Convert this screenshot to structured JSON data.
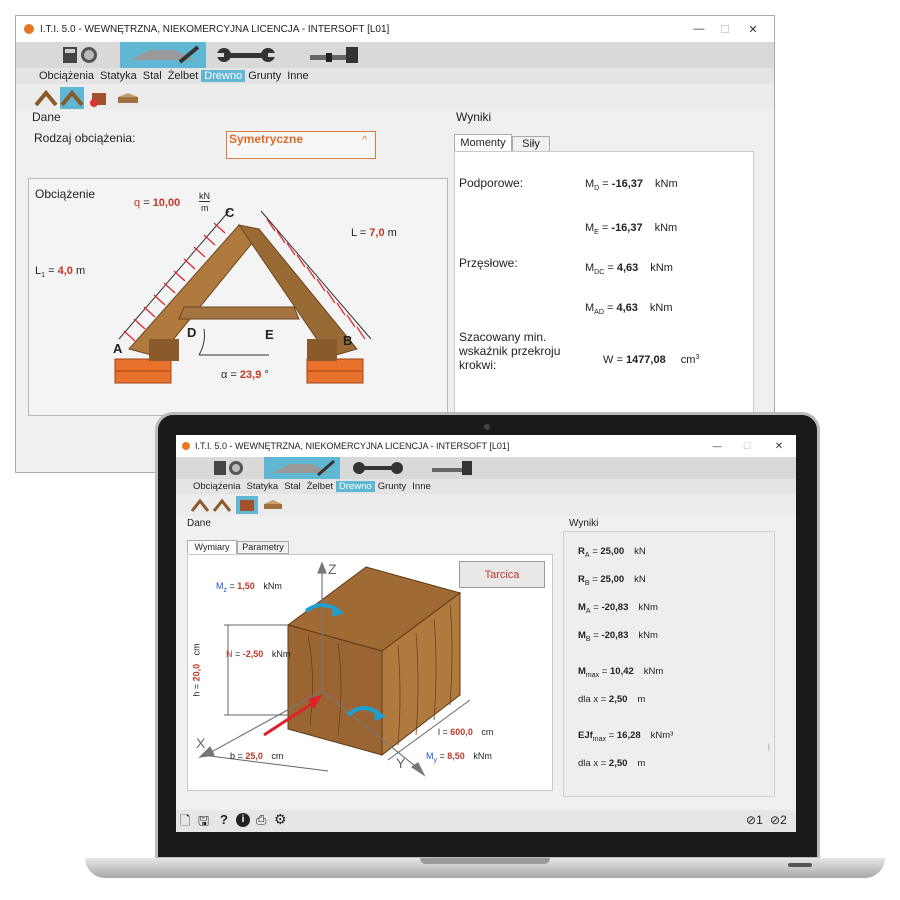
{
  "back": {
    "title": "I.T.I. 5.0 - WEWNĘTRZNA, NIEKOMERCYJNA LICENCJA - INTERSOFT [L01]",
    "controls": {
      "minimize": "—",
      "maximize": "☐",
      "close": "✕"
    },
    "menu": [
      "Obciążenia",
      "Statyka",
      "Stal",
      "Żelbet",
      "Drewno",
      "Grunty",
      "Inne"
    ],
    "menu_active_index": 4,
    "dane_title": "Dane",
    "rodzaj_label": "Rodzaj obciążenia:",
    "rodzaj_value": "Symetryczne",
    "obciazenie_label": "Obciążenie",
    "q_label": "q",
    "q_eq": "=",
    "q_value": "10,00",
    "q_unit_num": "kN",
    "q_unit_den": "m",
    "L1_label": "L",
    "L1_sub": "1",
    "L1_eq": "=",
    "L1_value": "4,0",
    "L1_unit": "m",
    "L_label": "L",
    "L_eq": "=",
    "L_value": "7,0",
    "L_unit": "m",
    "alpha_label": "α",
    "alpha_eq": "=",
    "alpha_value": "23,9",
    "alpha_unit": "°",
    "points": {
      "A": "A",
      "B": "B",
      "C": "C",
      "D": "D",
      "E": "E"
    },
    "wyniki_title": "Wyniki",
    "tabs": [
      "Momenty",
      "Siły"
    ],
    "podporowe_label": "Podporowe:",
    "przeslowe_label": "Przęsłowe:",
    "wskaznik_label": [
      "Szacowany min.",
      "wskaźnik przekroju",
      "krokwi:"
    ],
    "results": [
      {
        "sym": "M",
        "sub": "D",
        "eq": "=",
        "val": "-16,37",
        "unit": "kNm"
      },
      {
        "sym": "M",
        "sub": "E",
        "eq": "=",
        "val": "-16,37",
        "unit": "kNm"
      },
      {
        "sym": "M",
        "sub": "DC",
        "eq": "=",
        "val": "4,63",
        "unit": "kNm"
      },
      {
        "sym": "M",
        "sub": "AD",
        "eq": "=",
        "val": "4,63",
        "unit": "kNm"
      }
    ],
    "W": {
      "sym": "W",
      "eq": "=",
      "val": "1477,08",
      "unit": "cm",
      "unit_sup": "3"
    }
  },
  "front": {
    "title": "I.T.I. 5.0 - WEWNĘTRZNA, NIEKOMERCYJNA LICENCJA - INTERSOFT [L01]",
    "controls": {
      "minimize": "—",
      "maximize": "☐",
      "close": "✕"
    },
    "menu": [
      "Obciążenia",
      "Statyka",
      "Stal",
      "Żelbet",
      "Drewno",
      "Grunty",
      "Inne"
    ],
    "menu_active_index": 4,
    "dane_title": "Dane",
    "tabs": [
      "Wymiary",
      "Parametry"
    ],
    "tarcica_button": "Tarcica",
    "Mz": {
      "sym": "M",
      "sub": "z",
      "eq": "=",
      "val": "1,50",
      "unit": "kNm"
    },
    "N": {
      "sym": "N",
      "eq": "=",
      "val": "-2,50",
      "unit": "kNm"
    },
    "h": {
      "sym": "h",
      "eq": "=",
      "val": "20,0",
      "unit": "cm"
    },
    "b": {
      "sym": "b",
      "eq": "=",
      "val": "25,0",
      "unit": "cm"
    },
    "l": {
      "sym": "l",
      "eq": "=",
      "val": "600,0",
      "unit": "cm"
    },
    "My": {
      "sym": "M",
      "sub": "y",
      "eq": "=",
      "val": "8,50",
      "unit": "kNm"
    },
    "axes": {
      "x": "X",
      "y": "Y",
      "z": "Z"
    },
    "wyniki_title": "Wyniki",
    "results": [
      {
        "sym": "R",
        "sub": "A",
        "eq": "=",
        "val": "25,00",
        "unit": "kN"
      },
      {
        "sym": "R",
        "sub": "B",
        "eq": "=",
        "val": "25,00",
        "unit": "kN"
      },
      {
        "sym": "M",
        "sub": "A",
        "eq": "=",
        "val": "-20,83",
        "unit": "kNm"
      },
      {
        "sym": "M",
        "sub": "B",
        "eq": "=",
        "val": "-20,83",
        "unit": "kNm"
      },
      {
        "sym": "M",
        "sub": "max",
        "eq": "=",
        "val": "10,42",
        "unit": "kNm"
      },
      {
        "sym": "dla x",
        "sub": "",
        "eq": "=",
        "val": "2,50",
        "unit": "m"
      },
      {
        "sym": "EJf",
        "sub": "max",
        "eq": "=",
        "val": "16,28",
        "unit": "kNm³"
      },
      {
        "sym": "dla x",
        "sub": "",
        "eq": "=",
        "val": "2,50",
        "unit": "m"
      }
    ],
    "status": {
      "sel1": "1",
      "sel2": "2"
    }
  },
  "colors": {
    "accent": "#5fb7d4",
    "value": "#c0392b",
    "brick": "#e8722b",
    "wood": "#b07a3f",
    "load": "#e0202a"
  }
}
